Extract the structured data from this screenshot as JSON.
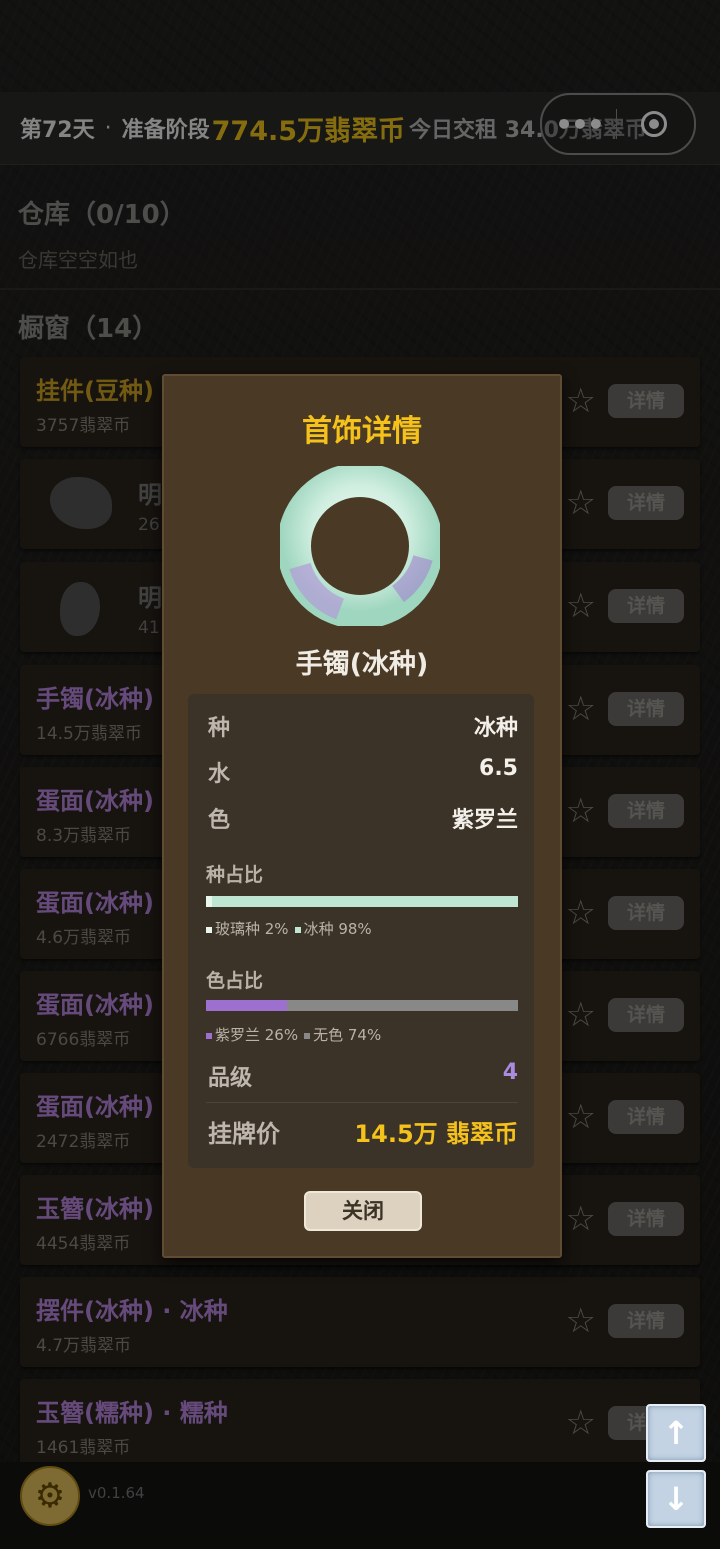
{
  "topbar": {
    "day": "第72天",
    "separator": "·",
    "phase": "准备阶段",
    "coins": "774.5万翡翠币",
    "rent": "今日交租  34.0万翡翠币"
  },
  "warehouse": {
    "title": "仓库（0/10）",
    "empty_text": "仓库空空如也"
  },
  "window": {
    "title": "橱窗（14）",
    "items": [
      {
        "name": "挂件(豆种)",
        "price": "3757翡翠币",
        "color": "#d0a522"
      },
      {
        "name": "明",
        "price": "26",
        "stone": true
      },
      {
        "name": "明",
        "price": "41",
        "stone": true
      },
      {
        "name": "手镯(冰种)",
        "price": "14.5万翡翠币",
        "color": "#b988e0"
      },
      {
        "name": "蛋面(冰种)",
        "price": "8.3万翡翠币",
        "color": "#b988e0"
      },
      {
        "name": "蛋面(冰种)",
        "price": "4.6万翡翠币",
        "color": "#b988e0"
      },
      {
        "name": "蛋面(冰种)",
        "price": "6766翡翠币",
        "color": "#b988e0"
      },
      {
        "name": "蛋面(冰种)",
        "price": "2472翡翠币",
        "color": "#b988e0"
      },
      {
        "name": "玉簪(冰种)",
        "price": "4454翡翠币",
        "color": "#b988e0"
      },
      {
        "name": "摆件(冰种) · 冰种",
        "price": "4.7万翡翠币",
        "color": "#b988e0"
      },
      {
        "name": "玉簪(糯种) · 糯种",
        "price": "1461翡翠币",
        "color": "#b988e0"
      }
    ],
    "detail_label": "详情",
    "star_icon": "star-outline-icon"
  },
  "footer": {
    "version": "v0.1.64",
    "settings_icon": "gear-icon"
  },
  "modal": {
    "title": "首饰详情",
    "item_name": "手镯(冰种)",
    "attributes": [
      {
        "key": "种",
        "value": "冰种"
      },
      {
        "key": "水",
        "value": "6.5"
      },
      {
        "key": "色",
        "value": "紫罗兰"
      }
    ],
    "type_ratio": {
      "title": "种占比",
      "segments": [
        {
          "label": "玻璃种",
          "percent": 2,
          "color": "#e8f6ee"
        },
        {
          "label": "冰种",
          "percent": 98,
          "color": "#bfe6d2"
        }
      ]
    },
    "color_ratio": {
      "title": "色占比",
      "segments": [
        {
          "label": "紫罗兰",
          "percent": 26,
          "color": "#9d6fcf"
        },
        {
          "label": "无色",
          "percent": 74,
          "color": "#888888"
        }
      ]
    },
    "grade": {
      "key": "品级",
      "value": "4"
    },
    "listing_price": {
      "key": "挂牌价",
      "value": "14.5万  翡翠币"
    },
    "close_label": "关闭"
  }
}
